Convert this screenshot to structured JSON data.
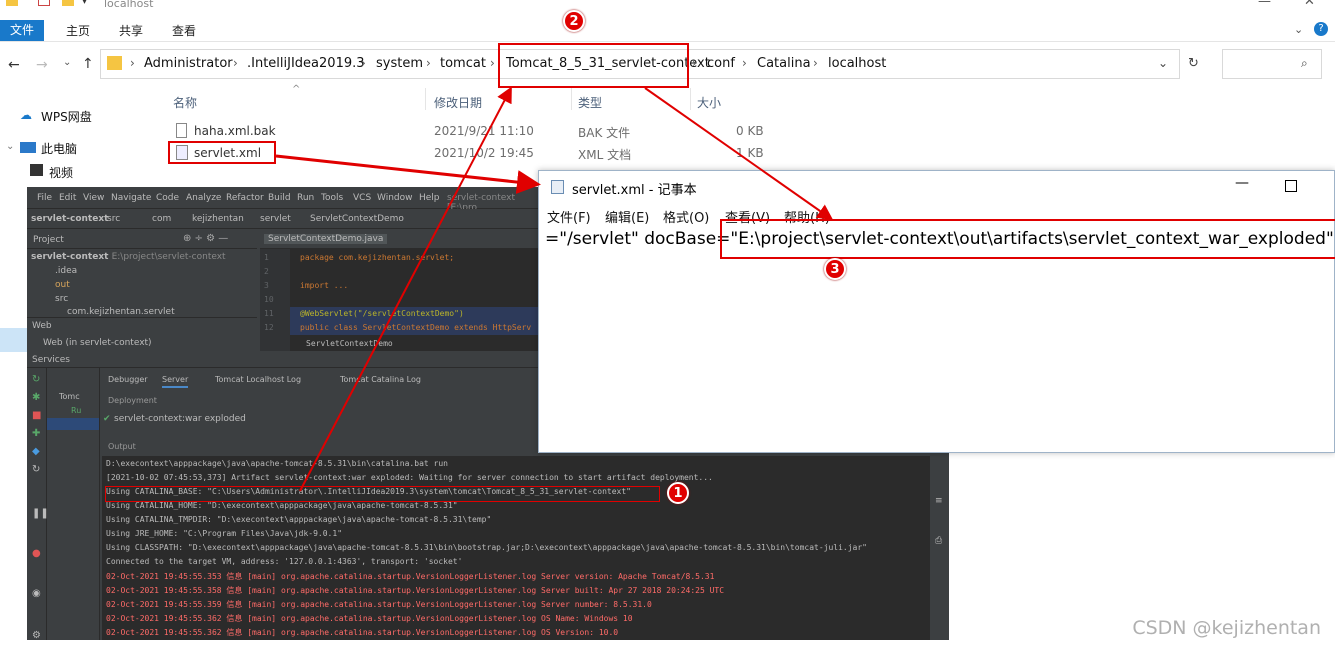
{
  "explorer": {
    "window_title": "localhost",
    "ribbon_tabs": [
      "文件",
      "主页",
      "共享",
      "查看"
    ],
    "breadcrumbs": [
      "Administrator",
      ".IntelliJIdea2019.3",
      "system",
      "tomcat",
      "Tomcat_8_5_31_servlet-context",
      "conf",
      "Catalina",
      "localhost"
    ],
    "columns": {
      "name": "名称",
      "modified": "修改日期",
      "type": "类型",
      "size": "大小"
    },
    "files": [
      {
        "name": "haha.xml.bak",
        "modified": "2021/9/21 11:10",
        "type": "BAK 文件",
        "size": "0 KB"
      },
      {
        "name": "servlet.xml",
        "modified": "2021/10/2 19:45",
        "type": "XML 文档",
        "size": "1 KB"
      }
    ],
    "sidebar": [
      "WPS网盘",
      "此电脑",
      "视频"
    ]
  },
  "notepad": {
    "title": "servlet.xml - 记事本",
    "menu": [
      "文件(F)",
      "编辑(E)",
      "格式(O)",
      "查看(V)",
      "帮助(H)"
    ],
    "text_prefix": "=\"/servlet\" docBase=",
    "text_value": "\"E:\\project\\servlet-context\\out\\artifacts\\servlet_context_war_exploded\" />"
  },
  "ide": {
    "menu": [
      "File",
      "Edit",
      "View",
      "Navigate",
      "Code",
      "Analyze",
      "Refactor",
      "Build",
      "Run",
      "Tools",
      "VCS",
      "Window",
      "Help",
      "servlet-context [E:\\pro"
    ],
    "crumbs": [
      "servlet-context",
      "src",
      "com",
      "kejizhentan",
      "servlet",
      "ServletContextDemo"
    ],
    "project_label": "Project",
    "editor_tab": "ServletContextDemo.java",
    "tree": [
      {
        "label": "servlet-context",
        "extra": "E:\\project\\servlet-context"
      },
      {
        "label": ".idea"
      },
      {
        "label": "out"
      },
      {
        "label": "src"
      },
      {
        "label": "com.kejizhentan.servlet"
      }
    ],
    "web_label": "Web",
    "web_item": "Web (in servlet-context)",
    "code_lines": [
      {
        "n": "1",
        "text": "package com.kejizhentan.servlet;"
      },
      {
        "n": "2",
        "text": ""
      },
      {
        "n": "3",
        "text": "import ..."
      },
      {
        "n": "10",
        "text": ""
      },
      {
        "n": "11",
        "text": "@WebServlet(\"/servletContextDemo\")"
      },
      {
        "n": "12",
        "text": "public class ServletContextDemo extends HttpServ"
      }
    ],
    "editor_footer": "ServletContextDemo"
  },
  "services": {
    "title": "Services",
    "tabs": [
      "Debugger",
      "Server",
      "Tomcat Localhost Log",
      "Tomcat Catalina Log"
    ],
    "tree_items": [
      "Tomc",
      "Ru"
    ],
    "deployment_label": "Deployment",
    "deployment_item": "servlet-context:war exploded",
    "output_label": "Output",
    "console_lines": [
      {
        "t": "D:\\execontext\\apppackage\\java\\apache-tomcat-8.5.31\\bin\\catalina.bat run",
        "red": false
      },
      {
        "t": "[2021-10-02 07:45:53,373] Artifact servlet-context:war exploded: Waiting for server connection to start artifact deployment...",
        "red": false
      },
      {
        "t": "Using CATALINA_BASE:   \"C:\\Users\\Administrator\\.IntelliJIdea2019.3\\system\\tomcat\\Tomcat_8_5_31_servlet-context\"",
        "red": false
      },
      {
        "t": "Using CATALINA_HOME:   \"D:\\execontext\\apppackage\\java\\apache-tomcat-8.5.31\"",
        "red": false
      },
      {
        "t": "Using CATALINA_TMPDIR: \"D:\\execontext\\apppackage\\java\\apache-tomcat-8.5.31\\temp\"",
        "red": false
      },
      {
        "t": "Using JRE_HOME:        \"C:\\Program Files\\Java\\jdk-9.0.1\"",
        "red": false
      },
      {
        "t": "Using CLASSPATH:       \"D:\\execontext\\apppackage\\java\\apache-tomcat-8.5.31\\bin\\bootstrap.jar;D:\\execontext\\apppackage\\java\\apache-tomcat-8.5.31\\bin\\tomcat-juli.jar\"",
        "red": false
      },
      {
        "t": "Connected to the target VM, address: '127.0.0.1:4363', transport: 'socket'",
        "red": false
      },
      {
        "t": "02-Oct-2021 19:45:55.353 信息 [main] org.apache.catalina.startup.VersionLoggerListener.log Server version:        Apache Tomcat/8.5.31",
        "red": true
      },
      {
        "t": "02-Oct-2021 19:45:55.358 信息 [main] org.apache.catalina.startup.VersionLoggerListener.log Server built:          Apr 27 2018 20:24:25 UTC",
        "red": true
      },
      {
        "t": "02-Oct-2021 19:45:55.359 信息 [main] org.apache.catalina.startup.VersionLoggerListener.log Server number:         8.5.31.0",
        "red": true
      },
      {
        "t": "02-Oct-2021 19:45:55.362 信息 [main] org.apache.catalina.startup.VersionLoggerListener.log OS Name:               Windows 10",
        "red": true
      },
      {
        "t": "02-Oct-2021 19:45:55.362 信息 [main] org.apache.catalina.startup.VersionLoggerListener.log OS Version:            10.0",
        "red": true
      }
    ]
  },
  "annotations": {
    "one": "1",
    "two": "2",
    "three": "3"
  },
  "watermark": "CSDN @kejizhentan"
}
